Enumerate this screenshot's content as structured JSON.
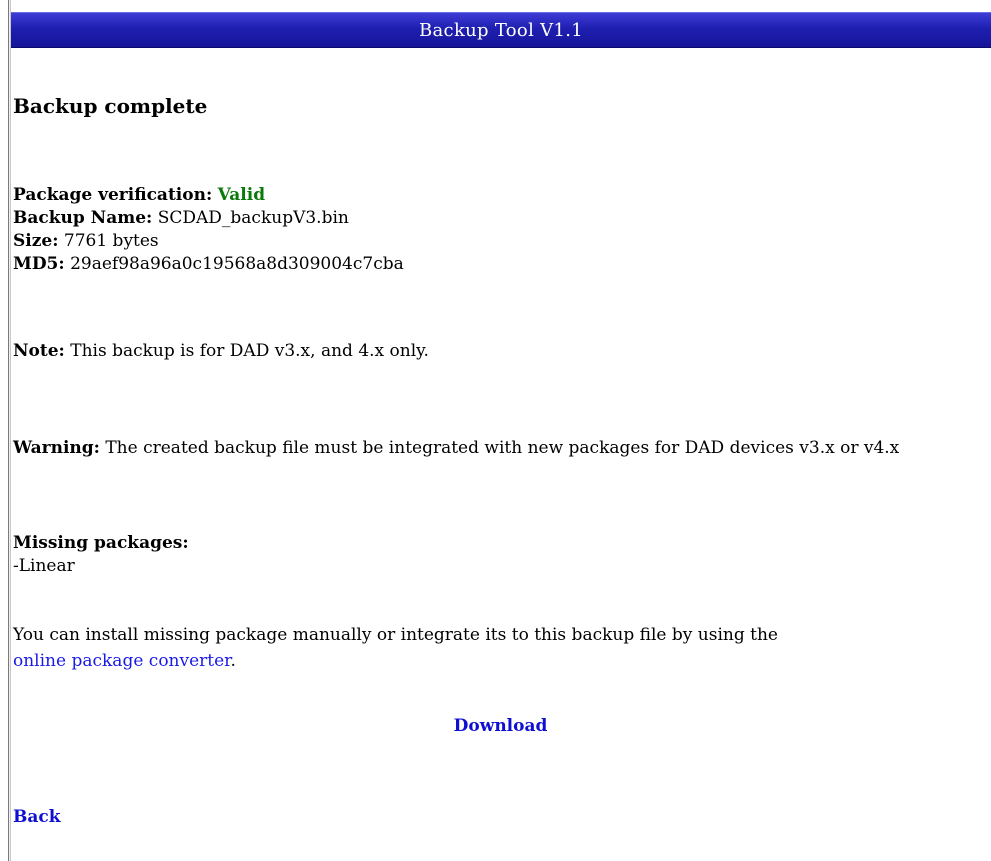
{
  "window": {
    "title": "Backup Tool V1.1"
  },
  "main": {
    "heading": "Backup complete",
    "verification": {
      "label": "Package verification:",
      "value": "Valid",
      "value_color": "#0a7a0a"
    },
    "backup_name": {
      "label": "Backup Name:",
      "value": "SCDAD_backupV3.bin"
    },
    "size": {
      "label": "Size:",
      "value": "7761 bytes"
    },
    "md5": {
      "label": "MD5:",
      "value": "29aef98a96a0c19568a8d309004c7cba"
    },
    "note": {
      "label": "Note:",
      "text": "This backup is for DAD v3.x, and 4.x only."
    },
    "warning": {
      "label": "Warning:",
      "text": "The created backup file must be integrated with new packages for DAD devices v3.x or v4.x"
    },
    "missing_packages": {
      "label": "Missing packages:",
      "items": [
        "-Linear"
      ]
    },
    "install_text": "You can install missing package manually or integrate its to this backup file by using the",
    "converter_link": "online package converter",
    "install_suffix": ".",
    "download_label": "Download",
    "back_label": "Back"
  },
  "colors": {
    "title_bar": "#1f1fb0",
    "link": "#1a1ae6"
  }
}
